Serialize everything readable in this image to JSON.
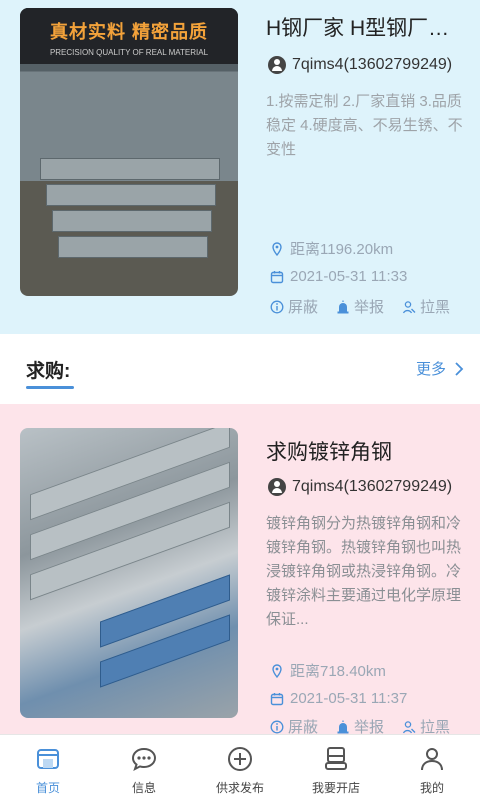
{
  "supply": {
    "thumb_banner_title": "真材实料 精密品质",
    "thumb_banner_sub": "PRECISION QUALITY OF REAL MATERIAL",
    "title": "H钢厂家 H型钢厂家 H型钢",
    "user": "7qims4(13602799249)",
    "description": "1.按需定制 2.厂家直销 3.品质稳定 4.硬度高、不易生锈、不变性",
    "distance": "距离1196.20km",
    "date": "2021-05-31 11:33",
    "actions": {
      "block": "屏蔽",
      "report": "举报",
      "blacklist": "拉黑"
    }
  },
  "section": {
    "title": "求购:",
    "more": "更多"
  },
  "demand": {
    "title": "求购镀锌角钢",
    "user": "7qims4(13602799249)",
    "description": "镀锌角钢分为热镀锌角钢和冷镀锌角钢。热镀锌角钢也叫热浸镀锌角钢或热浸锌角钢。冷镀锌涂料主要通过电化学原理保证...",
    "distance": "距离718.40km",
    "date": "2021-05-31 11:37",
    "actions": {
      "block": "屏蔽",
      "report": "举报",
      "blacklist": "拉黑"
    }
  },
  "tabbar": {
    "items": [
      {
        "label": "首页",
        "icon": "home-icon",
        "active": true
      },
      {
        "label": "信息",
        "icon": "message-icon",
        "active": false
      },
      {
        "label": "供求发布",
        "icon": "add-circle-icon",
        "active": false
      },
      {
        "label": "我要开店",
        "icon": "store-icon",
        "active": false
      },
      {
        "label": "我的",
        "icon": "person-icon",
        "active": false
      }
    ]
  },
  "colors": {
    "accent": "#4a90d9",
    "supply_bg": "#def3fb",
    "demand_bg": "#fde4ea"
  }
}
